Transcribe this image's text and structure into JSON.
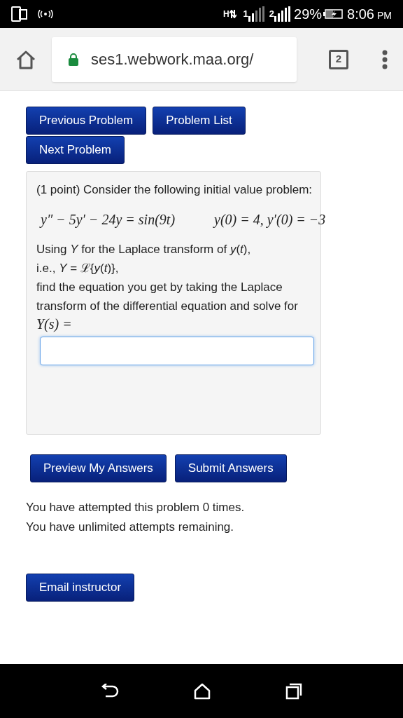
{
  "status_bar": {
    "network": "H",
    "sim_1": "1",
    "sim_2": "2",
    "battery": "29%",
    "time": "8:06",
    "ampm": "PM"
  },
  "browser": {
    "url": "ses1.webwork.maa.org/",
    "tab_count": "2"
  },
  "nav_buttons": [
    "Previous Problem",
    "Problem List",
    "Next Problem"
  ],
  "problem": {
    "intro": "(1 point) Consider the following initial value problem:",
    "equation": "y″ − 5y′ − 24y = sin(9t)",
    "conditions": "y(0) = 4,  y′(0) = −3",
    "lines": [
      "Using *Y* for the Laplace transform of *y*(*t*),",
      "i.e., *Y* = ℒ{*y*(*t*)},",
      "find the equation you get by taking the Laplace transform of the differential equation and solve for"
    ],
    "answer_label": "Y(s) =",
    "answer": {
      "focused": true
    }
  },
  "action_buttons": [
    "Preview My Answers",
    "Submit Answers"
  ],
  "messages": [
    "You have attempted this problem 0 times.",
    "You have unlimited attempts remaining."
  ],
  "email_button": "Email instructor"
}
